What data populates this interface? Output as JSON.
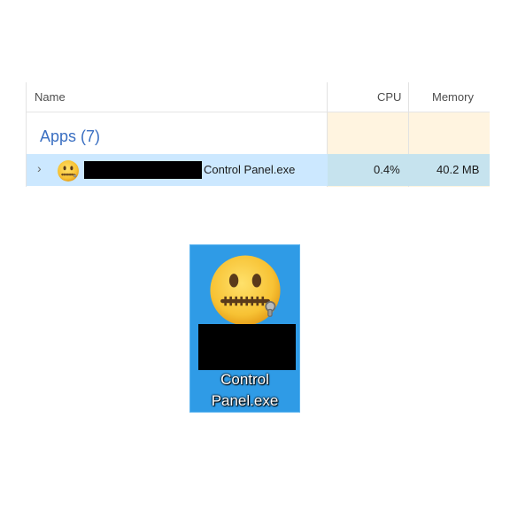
{
  "columns": {
    "name": "Name",
    "cpu": "CPU",
    "memory": "Memory"
  },
  "group": {
    "label": "Apps (7)"
  },
  "process": {
    "name": "Control Panel.exe",
    "cpu": "0.4%",
    "memory": "40.2 MB",
    "icon": "zipper-mouth-face-icon"
  },
  "desktop_icon": {
    "caption_line1": "Control",
    "caption_line2": "Panel.exe",
    "icon": "zipper-mouth-face-icon"
  },
  "colors": {
    "selection": "#cce8ff",
    "heat": "#fff4e0",
    "group_text": "#3a6fc2",
    "icon_tile": "#2f9be6"
  }
}
